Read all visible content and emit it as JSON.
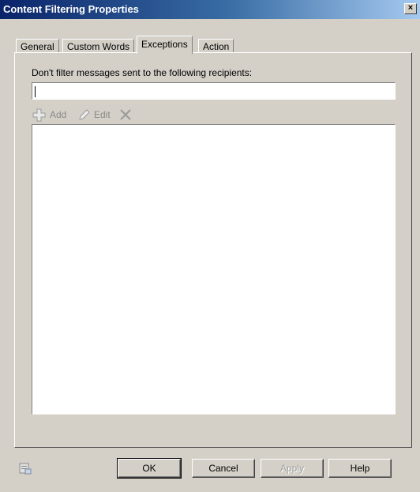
{
  "window": {
    "title": "Content Filtering Properties",
    "close_label": "×"
  },
  "tabs": [
    {
      "label": "General"
    },
    {
      "label": "Custom Words"
    },
    {
      "label": "Exceptions"
    },
    {
      "label": "Action"
    }
  ],
  "active_tab": "Exceptions",
  "exceptions": {
    "label": "Don't filter messages sent to the following recipients:",
    "recipient_value": "",
    "toolbar": {
      "add_label": "Add",
      "edit_label": "Edit"
    },
    "recipients": []
  },
  "buttons": {
    "ok": "OK",
    "cancel": "Cancel",
    "apply": "Apply",
    "help": "Help"
  },
  "icons": {
    "add": "plus-icon",
    "edit": "pencil-icon",
    "remove": "x-icon",
    "close": "close-icon",
    "properties_help": "properties-icon"
  }
}
